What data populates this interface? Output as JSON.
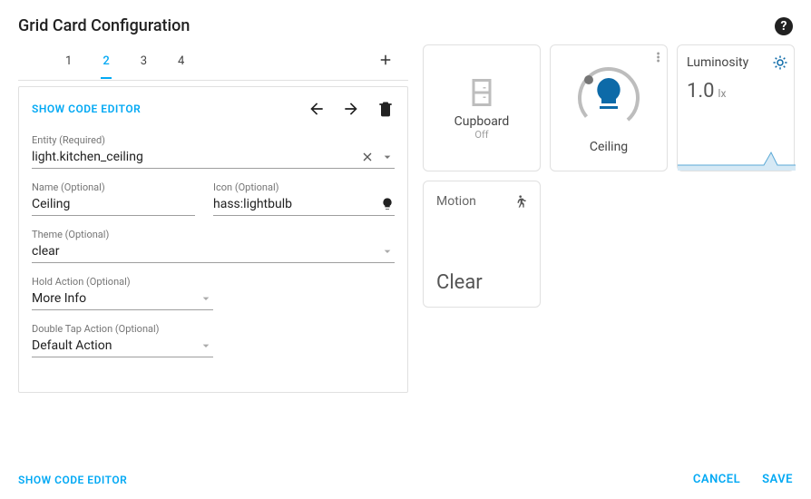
{
  "header": {
    "title": "Grid Card Configuration"
  },
  "tabs": {
    "items": [
      "1",
      "2",
      "3",
      "4"
    ],
    "active_index": 1
  },
  "panel": {
    "show_code_label": "Show Code Editor",
    "entity": {
      "label": "Entity (Required)",
      "value": "light.kitchen_ceiling"
    },
    "name": {
      "label": "Name (Optional)",
      "value": "Ceiling"
    },
    "icon": {
      "label": "Icon (Optional)",
      "value": "hass:lightbulb"
    },
    "theme": {
      "label": "Theme (Optional)",
      "value": "clear"
    },
    "hold": {
      "label": "Hold Action (Optional)",
      "value": "More Info"
    },
    "dtap": {
      "label": "Double Tap Action (Optional)",
      "value": "Default Action"
    }
  },
  "preview": {
    "cupboard": {
      "title": "Cupboard",
      "state": "Off"
    },
    "ceiling": {
      "title": "Ceiling"
    },
    "luminosity": {
      "title": "Luminosity",
      "value": "1.0",
      "unit": "lx"
    },
    "motion": {
      "title": "Motion",
      "state": "Clear"
    }
  },
  "footer": {
    "show_code_label": "Show Code Editor",
    "cancel": "Cancel",
    "save": "Save"
  }
}
